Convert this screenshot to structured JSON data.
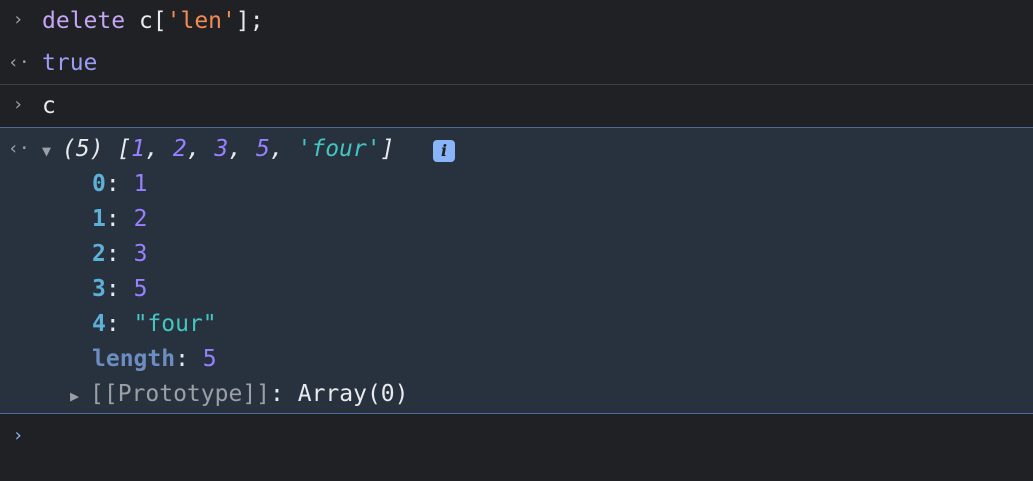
{
  "console": {
    "entries": [
      {
        "type": "input",
        "prompt_icon": "chevron-right-icon",
        "tokens": {
          "t1": "delete",
          "t2": " c[",
          "t3": "'len'",
          "t4": "];"
        }
      },
      {
        "type": "output",
        "prompt_icon": "return-arrow-icon",
        "value": "true"
      },
      {
        "type": "input",
        "prompt_icon": "chevron-right-icon",
        "value": "c"
      },
      {
        "type": "output-expanded",
        "prompt_icon": "return-arrow-icon",
        "summary": {
          "length_label": "(5)",
          "open": "[",
          "v1": "1",
          "v2": "2",
          "v3": "3",
          "v4": "5",
          "v5": "'four'",
          "close": "]",
          "comma": ", ",
          "info_icon": "info-icon",
          "info_glyph": "i"
        },
        "properties": [
          {
            "key": "0",
            "value": "1"
          },
          {
            "key": "1",
            "value": "2"
          },
          {
            "key": "2",
            "value": "3"
          },
          {
            "key": "3",
            "value": "5"
          },
          {
            "key": "4",
            "value": "\"four\""
          },
          {
            "key": "length",
            "value": "5"
          }
        ],
        "prototype": {
          "label": "[[Prototype]]",
          "value": "Array(0)"
        },
        "colon": ": "
      }
    ],
    "prompt": {
      "icon": "chevron-right-icon",
      "value": ""
    }
  },
  "colors": {
    "background": "#202124",
    "expanded_background": "#28323e",
    "accent_border": "#4b6b9c",
    "keyword": "#c5a5f6",
    "string": "#f28b54",
    "number": "#9980ff",
    "string_value": "#5db0d7"
  }
}
